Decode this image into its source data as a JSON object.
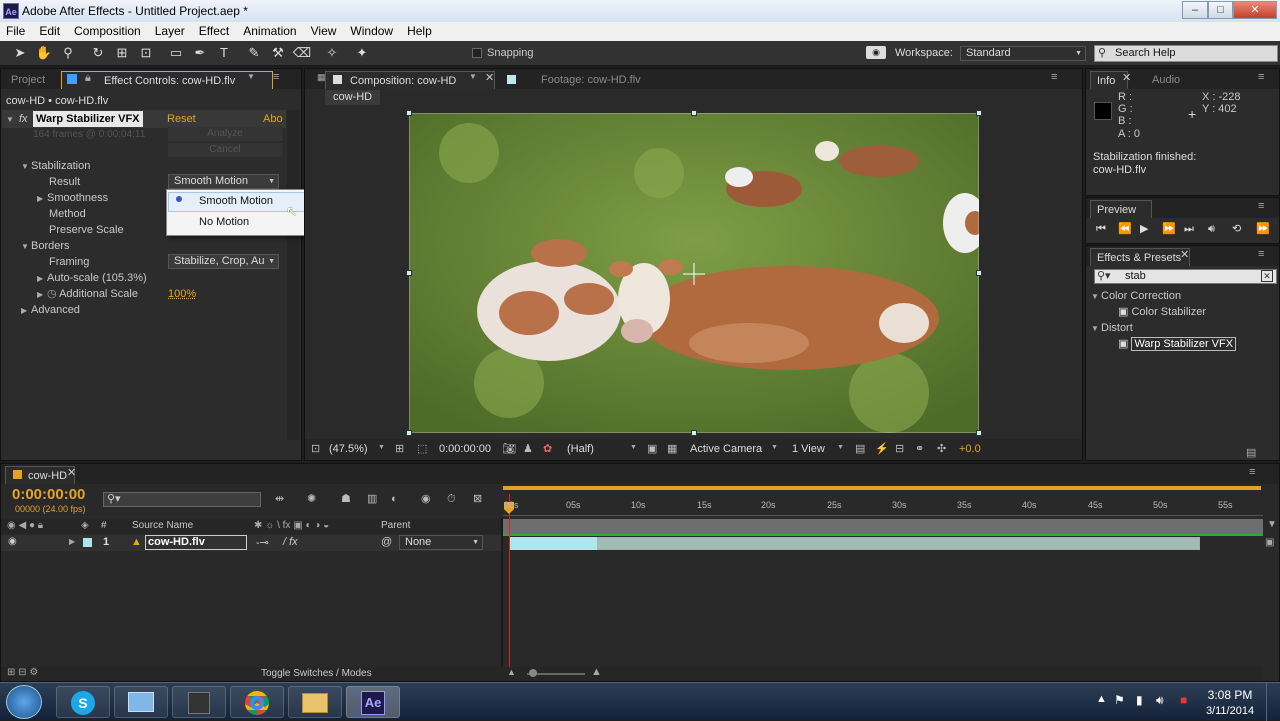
{
  "window": {
    "title": "Adobe After Effects - Untitled Project.aep *",
    "app_badge": "Ae"
  },
  "menu": [
    "File",
    "Edit",
    "Composition",
    "Layer",
    "Effect",
    "Animation",
    "View",
    "Window",
    "Help"
  ],
  "toolbar": {
    "snapping_label": "Snapping",
    "workspace_label": "Workspace:",
    "workspace_value": "Standard",
    "search_help": "Search Help"
  },
  "left_panel": {
    "tabs": [
      "Project",
      "Effect Controls: cow-HD.flv"
    ],
    "breadcrumb": "cow-HD • cow-HD.flv",
    "effect_name": "Warp Stabilizer VFX",
    "reset": "Reset",
    "about": "Abo",
    "frames_info": "164 frames @ 0:00:04:11",
    "analyze": "Analyze",
    "cancel": "Cancel",
    "stabilization": "Stabilization",
    "result_label": "Result",
    "result_value": "Smooth Motion",
    "smoothness": "Smoothness",
    "method": "Method",
    "preserve_scale": "Preserve Scale",
    "borders": "Borders",
    "framing_label": "Framing",
    "framing_value": "Stabilize, Crop, Au",
    "autoscale": "Auto-scale (105.3%)",
    "additional_scale": "Additional Scale",
    "additional_scale_value": "100%",
    "advanced": "Advanced",
    "dropdown_options": [
      "Smooth Motion",
      "No Motion"
    ]
  },
  "comp_panel": {
    "tab_comp": "Composition: cow-HD",
    "tab_footage": "Footage: cow-HD.flv",
    "comp_chip": "cow-HD",
    "zoom": "(47.5%)",
    "timecode": "0:00:00:00",
    "resolution": "(Half)",
    "camera": "Active Camera",
    "views": "1 View",
    "exposure": "+0.0"
  },
  "info_panel": {
    "tabs": [
      "Info",
      "Audio"
    ],
    "r": "R :",
    "g": "G :",
    "b": "B :",
    "a": "A : 0",
    "x": "X : -228",
    "y": "Y : 402",
    "status_line1": "Stabilization finished:",
    "status_line2": "cow-HD.flv"
  },
  "preview_panel": {
    "title": "Preview"
  },
  "effects_panel": {
    "title": "Effects & Presets",
    "search": "stab",
    "cat1": "Color Correction",
    "item1": "Color Stabilizer",
    "cat2": "Distort",
    "item2": "Warp Stabilizer VFX"
  },
  "timeline": {
    "tab": "cow-HD",
    "timecode": "0:00:00:00",
    "frames": "00000 (24.00 fps)",
    "col_hash": "#",
    "col_source": "Source Name",
    "col_parent": "Parent",
    "layer_num": "1",
    "layer_name": "cow-HD.flv",
    "parent_value": "None",
    "ticks": [
      "00s",
      "05s",
      "10s",
      "15s",
      "20s",
      "25s",
      "30s",
      "35s",
      "40s",
      "45s",
      "50s",
      "55s"
    ],
    "toggle": "Toggle Switches / Modes"
  },
  "taskbar": {
    "time": "3:08 PM",
    "date": "3/11/2014",
    "ae_label": "Ae"
  },
  "colors": {
    "accent": "#e5a325",
    "ae_purple": "#1d1a4a",
    "layer_bar": "#aee6ee",
    "playhead": "#e02020"
  }
}
